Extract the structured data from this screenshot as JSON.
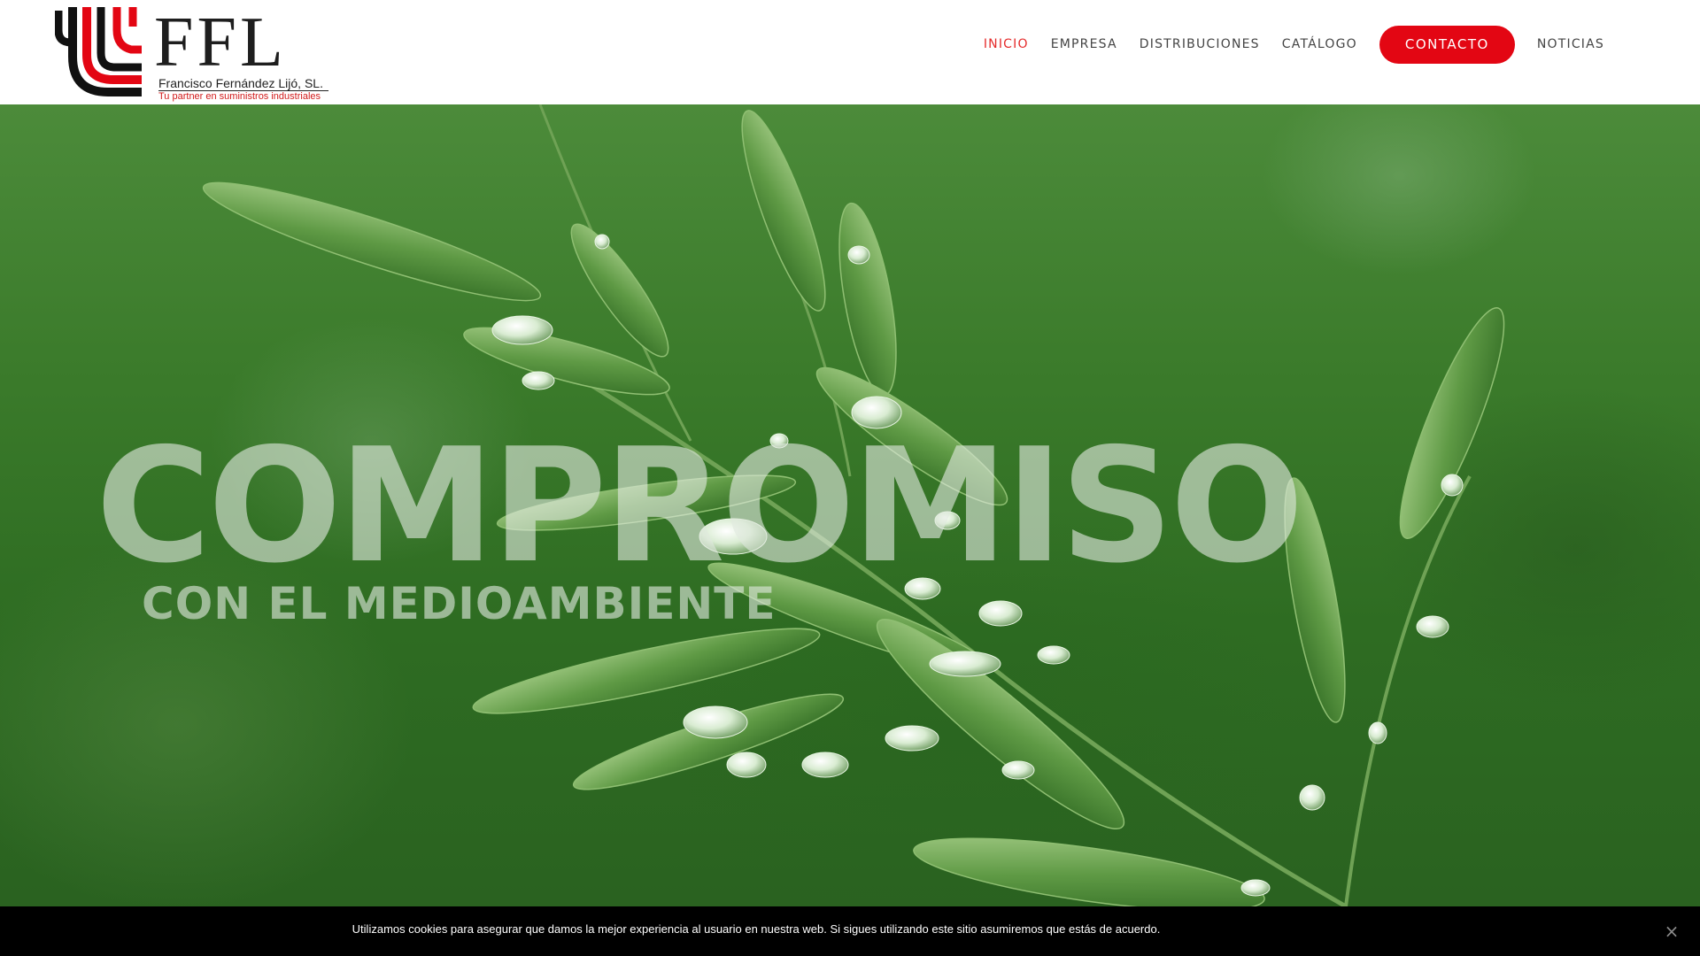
{
  "logo": {
    "wordmark": "FFL",
    "company": "Francisco Fernández Lijó, SL.",
    "tagline": "Tu partner en suministros industriales"
  },
  "nav": {
    "items": [
      {
        "label": "INICIO",
        "active": true
      },
      {
        "label": "EMPRESA",
        "active": false
      },
      {
        "label": "DISTRIBUCIONES",
        "active": false
      },
      {
        "label": "CATÁLOGO",
        "active": false
      }
    ],
    "contact_label": "CONTACTO",
    "news_label": "NOTICIAS"
  },
  "hero": {
    "headline": "COMPROMISO",
    "subheadline": "CON EL MEDIOAMBIENTE"
  },
  "cookie": {
    "text": "Utilizamos cookies para asegurar que damos la mejor experiencia al usuario en nuestra web. Si sigues utilizando este sitio asumiremos que estás de acuerdo.",
    "close_glyph": "×"
  },
  "colors": {
    "brand_red": "#e30613",
    "active_nav": "#e52b2b",
    "nav_text": "#444444",
    "cookie_bg": "#000000"
  },
  "icons": {
    "logo_mark": "ffl-logo-mark",
    "close": "close-icon"
  }
}
